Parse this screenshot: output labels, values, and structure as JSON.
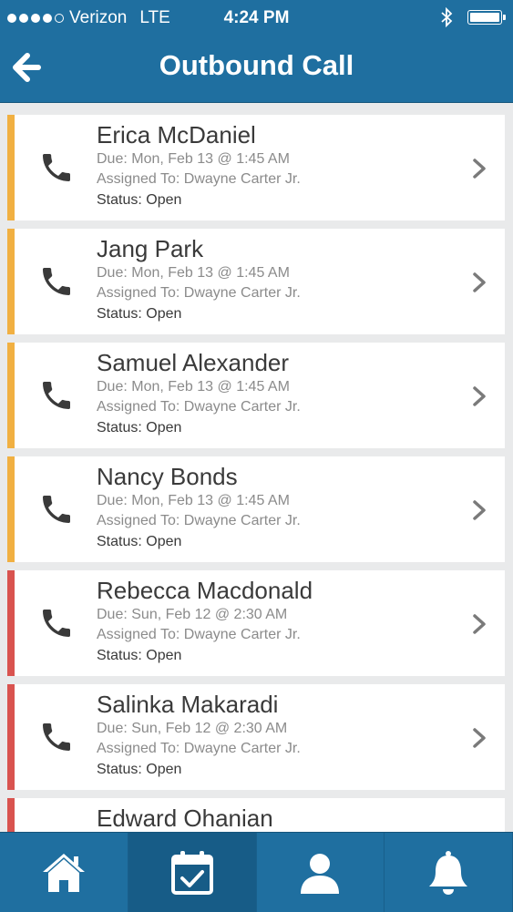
{
  "status_bar": {
    "carrier": "Verizon",
    "network": "LTE",
    "time": "4:24 PM",
    "signal_bars": 4,
    "battery_level": 1.0
  },
  "header": {
    "title": "Outbound Call",
    "back_icon": "back-arrow-icon"
  },
  "colors": {
    "primary": "#1f6fa0",
    "accent_upcoming": "#f1b042",
    "accent_overdue": "#d9534f"
  },
  "tasks": [
    {
      "name": "Erica McDaniel",
      "due": "Due: Mon, Feb 13 @ 1:45 AM",
      "assigned": "Assigned To: Dwayne Carter Jr.",
      "status": "Status: Open",
      "accent": "#f1b042"
    },
    {
      "name": "Jang Park",
      "due": "Due: Mon, Feb 13 @ 1:45 AM",
      "assigned": "Assigned To: Dwayne Carter Jr.",
      "status": "Status: Open",
      "accent": "#f1b042"
    },
    {
      "name": "Samuel Alexander",
      "due": "Due: Mon, Feb 13 @ 1:45 AM",
      "assigned": "Assigned To: Dwayne Carter Jr.",
      "status": "Status: Open",
      "accent": "#f1b042"
    },
    {
      "name": "Nancy Bonds",
      "due": "Due: Mon, Feb 13 @ 1:45 AM",
      "assigned": "Assigned To: Dwayne Carter Jr.",
      "status": "Status: Open",
      "accent": "#f1b042"
    },
    {
      "name": "Rebecca Macdonald",
      "due": "Due: Sun, Feb 12 @ 2:30 AM",
      "assigned": "Assigned To: Dwayne Carter Jr.",
      "status": "Status: Open",
      "accent": "#d9534f"
    },
    {
      "name": "Salinka Makaradi",
      "due": "Due: Sun, Feb 12 @ 2:30 AM",
      "assigned": "Assigned To: Dwayne Carter Jr.",
      "status": "Status: Open",
      "accent": "#d9534f"
    },
    {
      "name": "Edward Ohanian",
      "due": "",
      "assigned": "",
      "status": "",
      "accent": "#d9534f"
    }
  ],
  "tab_bar": {
    "tabs": [
      {
        "icon": "home-icon",
        "active": false
      },
      {
        "icon": "calendar-check-icon",
        "active": true
      },
      {
        "icon": "user-icon",
        "active": false
      },
      {
        "icon": "bell-icon",
        "active": false
      }
    ]
  }
}
